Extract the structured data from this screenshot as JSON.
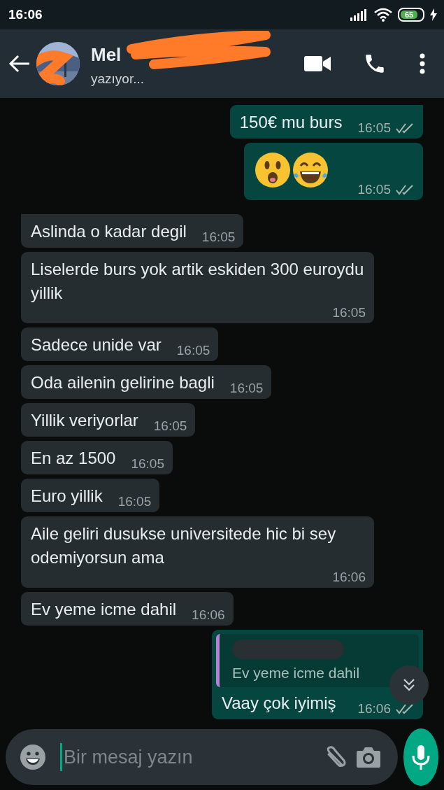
{
  "status_bar": {
    "time": "16:06",
    "battery": "65",
    "charging": true
  },
  "header": {
    "contact_name": "Mel",
    "name_redacted": true,
    "status": "yazıyor..."
  },
  "messages": [
    {
      "kind": "text",
      "outgoing": true,
      "tail": true,
      "text": "150€ mu burs",
      "time": "16:05",
      "delivered": true
    },
    {
      "kind": "emoji",
      "outgoing": true,
      "tail": false,
      "emojis": [
        {
          "kind": "astonished"
        },
        {
          "kind": "tears-of-joy"
        }
      ],
      "time": "16:05",
      "delivered": true
    },
    {
      "kind": "text",
      "outgoing": false,
      "tail": true,
      "text": "Aslinda o kadar degil",
      "time": "16:05"
    },
    {
      "kind": "text",
      "outgoing": false,
      "tail": false,
      "text": "Liselerde burs yok artik eskiden 300 euroydu yillik",
      "time": "16:05"
    },
    {
      "kind": "text",
      "outgoing": false,
      "tail": false,
      "text": "Sadece unide var",
      "time": "16:05"
    },
    {
      "kind": "text",
      "outgoing": false,
      "tail": false,
      "text": "Oda ailenin gelirine bagli",
      "time": "16:05"
    },
    {
      "kind": "text",
      "outgoing": false,
      "tail": false,
      "text": "Yillik veriyorlar",
      "time": "16:05"
    },
    {
      "kind": "text",
      "outgoing": false,
      "tail": false,
      "text": "En az 1500",
      "time": "16:05"
    },
    {
      "kind": "text",
      "outgoing": false,
      "tail": false,
      "text": "Euro yillik",
      "time": "16:05"
    },
    {
      "kind": "text",
      "outgoing": false,
      "tail": false,
      "text": "Aile geliri dusukse universitede hic bi sey odemiyorsun ama",
      "time": "16:06"
    },
    {
      "kind": "text",
      "outgoing": false,
      "tail": false,
      "text": "Ev yeme icme dahil",
      "time": "16:06"
    },
    {
      "kind": "reply",
      "outgoing": true,
      "tail": true,
      "quote": {
        "sender_redacted": true,
        "text": "Ev yeme icme dahil"
      },
      "text": "Vaay çok iyimiş",
      "time": "16:06",
      "delivered": true
    }
  ],
  "scroll_down_button": true,
  "composer": {
    "placeholder": "Bir mesaj yazın"
  }
}
